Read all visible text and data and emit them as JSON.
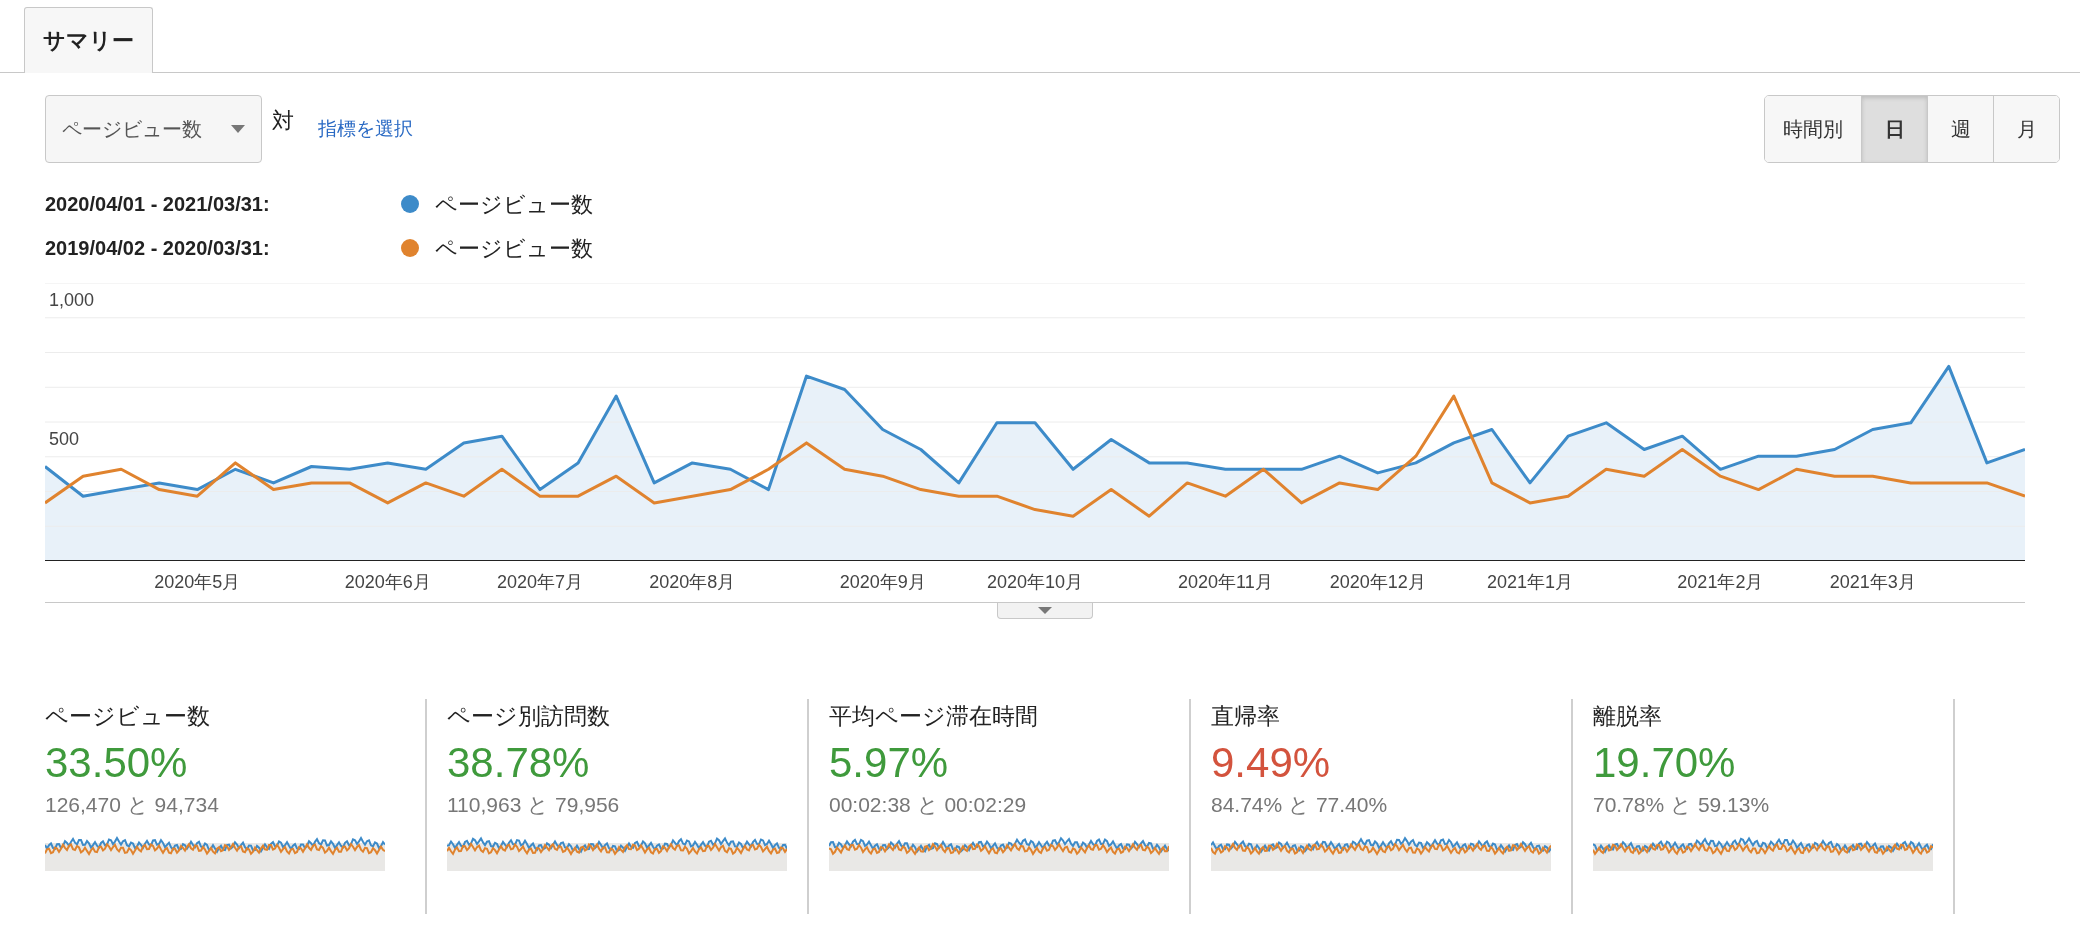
{
  "tabs": [
    {
      "label": "サマリー",
      "selected": true
    }
  ],
  "metric_select": {
    "value": "ページビュー数"
  },
  "versus": "対",
  "select_metric_link": "指標を選択",
  "granularity": [
    {
      "label": "時間別",
      "selected": false
    },
    {
      "label": "日",
      "selected": true
    },
    {
      "label": "週",
      "selected": false
    },
    {
      "label": "月",
      "selected": false
    }
  ],
  "legend": [
    {
      "range": "2020/04/01 - 2021/03/31:",
      "metric": "ページビュー数",
      "color": "#3d8bc9"
    },
    {
      "range": "2019/04/02 - 2020/03/31:",
      "metric": "ページビュー数",
      "color": "#e0832e"
    }
  ],
  "chart_data": {
    "type": "line",
    "categories": [
      null,
      null,
      null,
      null,
      "2020年5月",
      null,
      null,
      null,
      null,
      "2020年6月",
      null,
      null,
      null,
      "2020年7月",
      null,
      null,
      null,
      "2020年8月",
      null,
      null,
      null,
      null,
      "2020年9月",
      null,
      null,
      null,
      "2020年10月",
      null,
      null,
      null,
      null,
      "2020年11月",
      null,
      null,
      null,
      "2020年12月",
      null,
      null,
      null,
      "2021年1月",
      null,
      null,
      null,
      null,
      "2021年2月",
      null,
      null,
      null,
      "2021年3月",
      null,
      null,
      null,
      null
    ],
    "ylim": [
      0,
      1000
    ],
    "yticks": [
      {
        "value": 500,
        "label": "500"
      },
      {
        "value": 1000,
        "label": "1,000"
      }
    ],
    "series": [
      {
        "type": "area",
        "color": "#3d8bc9",
        "values": [
          340,
          233,
          257,
          281,
          257,
          330,
          281,
          340,
          330,
          353,
          330,
          425,
          449,
          257,
          353,
          593,
          281,
          353,
          330,
          257,
          665,
          617,
          473,
          401,
          281,
          497,
          497,
          330,
          437,
          353,
          353,
          330,
          330,
          330,
          377,
          317,
          353,
          425,
          473,
          281,
          449,
          497,
          401,
          449,
          330,
          377,
          377,
          401,
          473,
          497,
          700,
          353,
          401
        ]
      },
      {
        "type": "line",
        "color": "#e0832e",
        "values": [
          209,
          305,
          330,
          257,
          233,
          353,
          257,
          281,
          281,
          209,
          281,
          233,
          330,
          233,
          233,
          305,
          209,
          233,
          257,
          330,
          425,
          330,
          305,
          257,
          233,
          233,
          185,
          161,
          257,
          161,
          281,
          233,
          330,
          209,
          281,
          257,
          377,
          593,
          281,
          209,
          233,
          330,
          305,
          401,
          305,
          257,
          330,
          305,
          305,
          281,
          281,
          281,
          233
        ]
      }
    ]
  },
  "metrics": [
    {
      "label": "ページビュー数",
      "change": "33.50%",
      "color": "#3f9a3c",
      "comparison": "126,470 と 94,734"
    },
    {
      "label": "ページ別訪問数",
      "change": "38.78%",
      "color": "#3f9a3c",
      "comparison": "110,963 と 79,956"
    },
    {
      "label": "平均ページ滞在時間",
      "change": "5.97%",
      "color": "#3f9a3c",
      "comparison": "00:02:38 と 00:02:29"
    },
    {
      "label": "直帰率",
      "change": "9.49%",
      "color": "#d3533d",
      "comparison": "84.74% と 77.40%"
    },
    {
      "label": "離脱率",
      "change": "19.70%",
      "color": "#3f9a3c",
      "comparison": "70.78% と 59.13%"
    }
  ]
}
